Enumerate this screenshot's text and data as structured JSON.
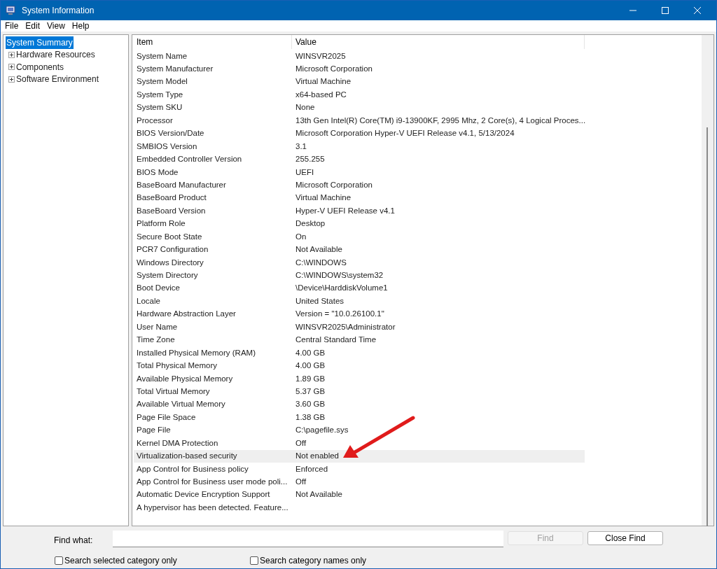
{
  "window": {
    "title": "System Information"
  },
  "menu": [
    "File",
    "Edit",
    "View",
    "Help"
  ],
  "tree": [
    {
      "label": "System Summary",
      "selected": true,
      "expandable": false
    },
    {
      "label": "Hardware Resources",
      "selected": false,
      "expandable": true
    },
    {
      "label": "Components",
      "selected": false,
      "expandable": true
    },
    {
      "label": "Software Environment",
      "selected": false,
      "expandable": true
    }
  ],
  "table": {
    "columns": [
      "Item",
      "Value"
    ],
    "rows": [
      {
        "item": "System Name",
        "value": "WINSVR2025",
        "selected": false
      },
      {
        "item": "System Manufacturer",
        "value": "Microsoft Corporation",
        "selected": false
      },
      {
        "item": "System Model",
        "value": "Virtual Machine",
        "selected": false
      },
      {
        "item": "System Type",
        "value": "x64-based PC",
        "selected": false
      },
      {
        "item": "System SKU",
        "value": "None",
        "selected": false
      },
      {
        "item": "Processor",
        "value": "13th Gen Intel(R) Core(TM) i9-13900KF, 2995 Mhz, 2 Core(s), 4 Logical Proces...",
        "selected": false
      },
      {
        "item": "BIOS Version/Date",
        "value": "Microsoft Corporation Hyper-V UEFI Release v4.1, 5/13/2024",
        "selected": false
      },
      {
        "item": "SMBIOS Version",
        "value": "3.1",
        "selected": false
      },
      {
        "item": "Embedded Controller Version",
        "value": "255.255",
        "selected": false
      },
      {
        "item": "BIOS Mode",
        "value": "UEFI",
        "selected": false
      },
      {
        "item": "BaseBoard Manufacturer",
        "value": "Microsoft Corporation",
        "selected": false
      },
      {
        "item": "BaseBoard Product",
        "value": "Virtual Machine",
        "selected": false
      },
      {
        "item": "BaseBoard Version",
        "value": "Hyper-V UEFI Release v4.1",
        "selected": false
      },
      {
        "item": "Platform Role",
        "value": "Desktop",
        "selected": false
      },
      {
        "item": "Secure Boot State",
        "value": "On",
        "selected": false
      },
      {
        "item": "PCR7 Configuration",
        "value": "Not Available",
        "selected": false
      },
      {
        "item": "Windows Directory",
        "value": "C:\\WINDOWS",
        "selected": false
      },
      {
        "item": "System Directory",
        "value": "C:\\WINDOWS\\system32",
        "selected": false
      },
      {
        "item": "Boot Device",
        "value": "\\Device\\HarddiskVolume1",
        "selected": false
      },
      {
        "item": "Locale",
        "value": "United States",
        "selected": false
      },
      {
        "item": "Hardware Abstraction Layer",
        "value": "Version = \"10.0.26100.1\"",
        "selected": false
      },
      {
        "item": "User Name",
        "value": "WINSVR2025\\Administrator",
        "selected": false
      },
      {
        "item": "Time Zone",
        "value": "Central Standard Time",
        "selected": false
      },
      {
        "item": "Installed Physical Memory (RAM)",
        "value": "4.00 GB",
        "selected": false
      },
      {
        "item": "Total Physical Memory",
        "value": "4.00 GB",
        "selected": false
      },
      {
        "item": "Available Physical Memory",
        "value": "1.89 GB",
        "selected": false
      },
      {
        "item": "Total Virtual Memory",
        "value": "5.37 GB",
        "selected": false
      },
      {
        "item": "Available Virtual Memory",
        "value": "3.60 GB",
        "selected": false
      },
      {
        "item": "Page File Space",
        "value": "1.38 GB",
        "selected": false
      },
      {
        "item": "Page File",
        "value": "C:\\pagefile.sys",
        "selected": false
      },
      {
        "item": "Kernel DMA Protection",
        "value": "Off",
        "selected": false
      },
      {
        "item": "Virtualization-based security",
        "value": "Not enabled",
        "selected": true
      },
      {
        "item": "App Control for Business policy",
        "value": "Enforced",
        "selected": false
      },
      {
        "item": "App Control for Business user mode poli...",
        "value": "Off",
        "selected": false
      },
      {
        "item": "Automatic Device Encryption Support",
        "value": "Not Available",
        "selected": false
      },
      {
        "item": "A hypervisor has been detected. Feature...",
        "selected": false
      }
    ]
  },
  "find": {
    "label": "Find what:",
    "find_button": {
      "label": "Find",
      "disabled": true
    },
    "close_button": "Close Find",
    "options": [
      {
        "label": "Search selected category only",
        "checked": false
      },
      {
        "label": "Search category names only",
        "checked": false
      }
    ]
  }
}
